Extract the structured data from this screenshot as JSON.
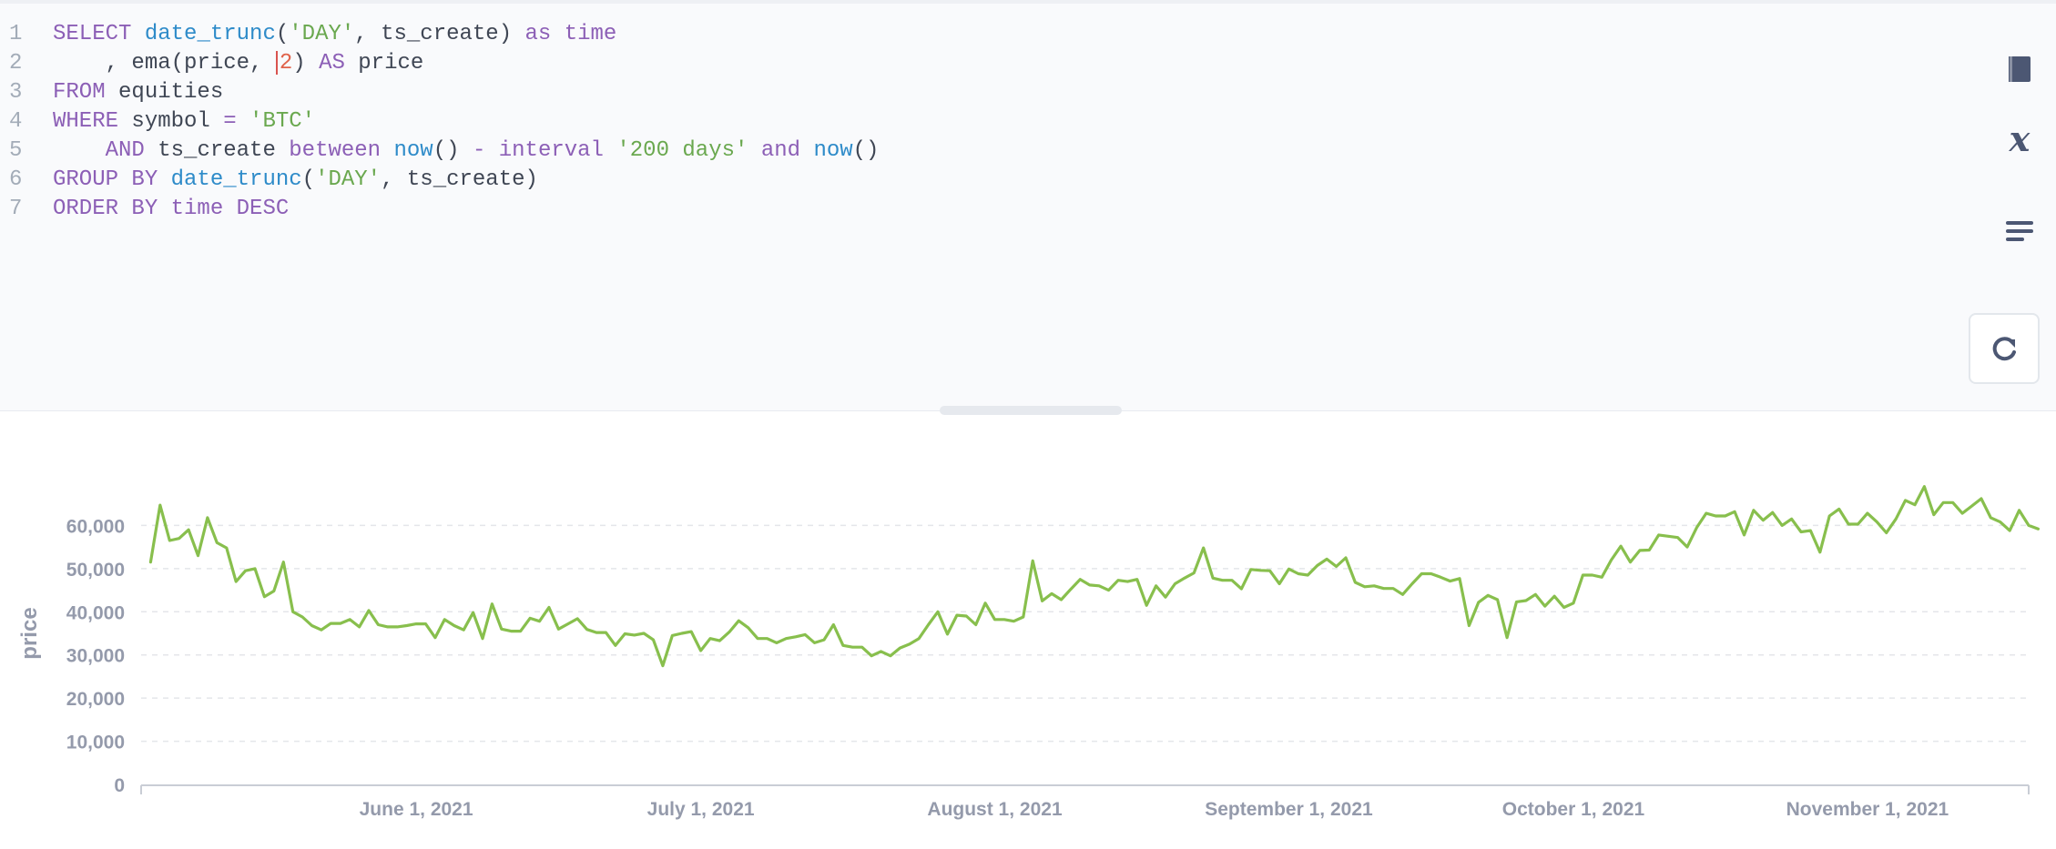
{
  "editor": {
    "lines": [
      {
        "no": "1",
        "tokens": [
          {
            "t": "SELECT ",
            "c": "kw"
          },
          {
            "t": "date_trunc",
            "c": "fn"
          },
          {
            "t": "(",
            "c": "txt"
          },
          {
            "t": "'DAY'",
            "c": "str"
          },
          {
            "t": ", ts_create) ",
            "c": "txt"
          },
          {
            "t": "as time",
            "c": "kw"
          }
        ]
      },
      {
        "no": "2",
        "tokens": [
          {
            "t": "    , ema(price, ",
            "c": "txt"
          },
          {
            "t": "|",
            "c": "cursor"
          },
          {
            "t": "2",
            "c": "num"
          },
          {
            "t": ") ",
            "c": "txt"
          },
          {
            "t": "AS",
            "c": "kw"
          },
          {
            "t": " price",
            "c": "txt"
          }
        ]
      },
      {
        "no": "3",
        "tokens": [
          {
            "t": "FROM",
            "c": "kw"
          },
          {
            "t": " equities",
            "c": "txt"
          }
        ]
      },
      {
        "no": "4",
        "tokens": [
          {
            "t": "WHERE",
            "c": "kw"
          },
          {
            "t": " symbol ",
            "c": "txt"
          },
          {
            "t": "=",
            "c": "kw"
          },
          {
            "t": " ",
            "c": "txt"
          },
          {
            "t": "'BTC'",
            "c": "str"
          }
        ]
      },
      {
        "no": "5",
        "tokens": [
          {
            "t": "    AND",
            "c": "kw"
          },
          {
            "t": " ts_create ",
            "c": "txt"
          },
          {
            "t": "between",
            "c": "kw"
          },
          {
            "t": " ",
            "c": "txt"
          },
          {
            "t": "now",
            "c": "fn"
          },
          {
            "t": "() ",
            "c": "txt"
          },
          {
            "t": "- interval",
            "c": "kw"
          },
          {
            "t": " ",
            "c": "txt"
          },
          {
            "t": "'200 days'",
            "c": "str"
          },
          {
            "t": " ",
            "c": "txt"
          },
          {
            "t": "and",
            "c": "kw"
          },
          {
            "t": " ",
            "c": "txt"
          },
          {
            "t": "now",
            "c": "fn"
          },
          {
            "t": "()",
            "c": "txt"
          }
        ]
      },
      {
        "no": "6",
        "tokens": [
          {
            "t": "GROUP BY",
            "c": "kw"
          },
          {
            "t": " ",
            "c": "txt"
          },
          {
            "t": "date_trunc",
            "c": "fn"
          },
          {
            "t": "(",
            "c": "txt"
          },
          {
            "t": "'DAY'",
            "c": "str"
          },
          {
            "t": ", ts_create)",
            "c": "txt"
          }
        ]
      },
      {
        "no": "7",
        "tokens": [
          {
            "t": "ORDER BY",
            "c": "kw"
          },
          {
            "t": " ",
            "c": "txt"
          },
          {
            "t": "time",
            "c": "kw"
          },
          {
            "t": " ",
            "c": "txt"
          },
          {
            "t": "DESC",
            "c": "kw"
          }
        ]
      }
    ]
  },
  "sidebar_icons": [
    "book-icon",
    "variable-icon",
    "format-icon"
  ],
  "run_button": {
    "icon": "refresh-icon"
  },
  "colors": {
    "line": "#88bf4d",
    "axis_text": "#949aab",
    "grid": "#e4e6ea"
  },
  "chart_data": {
    "type": "line",
    "ylabel": "price",
    "xlabel": "",
    "ylim": [
      0,
      70000
    ],
    "yticks": [
      0,
      10000,
      20000,
      30000,
      40000,
      50000,
      60000
    ],
    "ytick_labels": [
      "0",
      "10,000",
      "20,000",
      "30,000",
      "40,000",
      "50,000",
      "60,000"
    ],
    "x_start": "2021-05-03",
    "x_end": "2021-11-18",
    "xticks": [
      {
        "date": "2021-06-01",
        "label": "June 1, 2021"
      },
      {
        "date": "2021-07-01",
        "label": "July 1, 2021"
      },
      {
        "date": "2021-08-01",
        "label": "August 1, 2021"
      },
      {
        "date": "2021-09-01",
        "label": "September 1, 2021"
      },
      {
        "date": "2021-10-01",
        "label": "October 1, 2021"
      },
      {
        "date": "2021-11-01",
        "label": "November 1, 2021"
      }
    ],
    "grid": true,
    "series": [
      {
        "name": "price",
        "start_date": "2021-05-04",
        "values": [
          51500,
          64700,
          56500,
          57000,
          59000,
          53000,
          61800,
          56000,
          54800,
          47000,
          49500,
          50000,
          43500,
          44800,
          51500,
          40000,
          38800,
          36800,
          35800,
          37300,
          37300,
          38200,
          36500,
          40300,
          37000,
          36500,
          36500,
          36800,
          37200,
          37200,
          34000,
          38200,
          36800,
          35800,
          39800,
          33800,
          41800,
          36000,
          35500,
          35500,
          38500,
          37800,
          41000,
          36000,
          37200,
          38400,
          35900,
          35200,
          35200,
          32200,
          34900,
          34600,
          35000,
          33500,
          27500,
          34500,
          35000,
          35400,
          31000,
          33800,
          33300,
          35300,
          37900,
          36300,
          33800,
          33800,
          32800,
          33800,
          34200,
          34700,
          32800,
          33500,
          37000,
          32200,
          31800,
          31800,
          29800,
          30800,
          29800,
          31600,
          32500,
          33800,
          37000,
          40000,
          34800,
          39200,
          39000,
          37000,
          42000,
          38200,
          38200,
          37800,
          38800,
          51800,
          42500,
          44200,
          42800,
          45200,
          47500,
          46200,
          46000,
          45000,
          47300,
          47000,
          47500,
          41500,
          46000,
          43400,
          46500,
          47800,
          49000,
          54800,
          47800,
          47300,
          47300,
          45300,
          49800,
          49600,
          49500,
          46500,
          49900,
          48800,
          48500,
          50700,
          52200,
          50500,
          52500,
          46800,
          45800,
          46000,
          45400,
          45400,
          44000,
          46500,
          48800,
          48800,
          48000,
          47100,
          47700,
          36800,
          42200,
          43800,
          42800,
          34000,
          42300,
          42600,
          44000,
          41300,
          43600,
          41000,
          42000,
          48500,
          48500,
          48000,
          52000,
          55200,
          51500,
          54200,
          54300,
          57800,
          57500,
          57200,
          55000,
          59500,
          62800,
          62200,
          62200,
          63200,
          57800,
          63500,
          61200,
          63000,
          60000,
          61500,
          58500,
          58800,
          53800,
          62200,
          63800,
          60300,
          60300,
          62800,
          60800,
          58300,
          61500,
          65800,
          64800,
          69000,
          62500,
          65300,
          65300,
          62800,
          64500,
          66200,
          61800,
          60800,
          58800,
          63500,
          60000,
          59200
        ]
      }
    ]
  }
}
